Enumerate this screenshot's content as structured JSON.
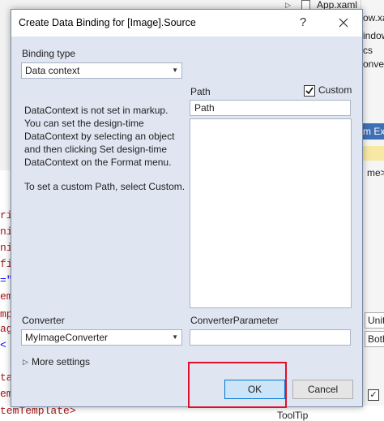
{
  "background": {
    "tree_item": "App.xaml",
    "right_panel_fragments": [
      "ow.xa",
      "indow",
      "cs",
      "onve"
    ],
    "right_panel_header": "m Exp",
    "right_panel_field_1": "me>",
    "right_panel_field_2": "Unit",
    "right_panel_field_3": "Both",
    "tooltip_label": "ToolTip",
    "code_fragments": [
      "ri",
      "ni",
      "ni",
      "fi",
      "=\"",
      "em",
      "mp",
      "ag",
      "<",
      "ta",
      "em"
    ],
    "code_bottom_line": "temTemplate>"
  },
  "dialog": {
    "title": "Create Data Binding for [Image].Source",
    "help_glyph": "?",
    "binding_type_label": "Binding type",
    "binding_type_value": "Data context",
    "path_label": "Path",
    "custom_label": "Custom",
    "custom_checked": true,
    "path_value": "Path",
    "info_para_1": "DataContext is not set in markup. You can set the design-time DataContext by selecting an object and then clicking Set design-time DataContext on the Format menu.",
    "info_para_2": "To set a custom Path, select Custom.",
    "converter_label": "Converter",
    "converter_value": "MyImageConverter",
    "converter_parameter_label": "ConverterParameter",
    "converter_parameter_value": "",
    "more_settings_label": "More settings",
    "ok_label": "OK",
    "cancel_label": "Cancel"
  },
  "colors": {
    "dialog_bg": "#dfe6f2",
    "highlight": "#e0102a",
    "ok_button_bg": "#cce4f7",
    "ok_button_border": "#0078d7"
  }
}
